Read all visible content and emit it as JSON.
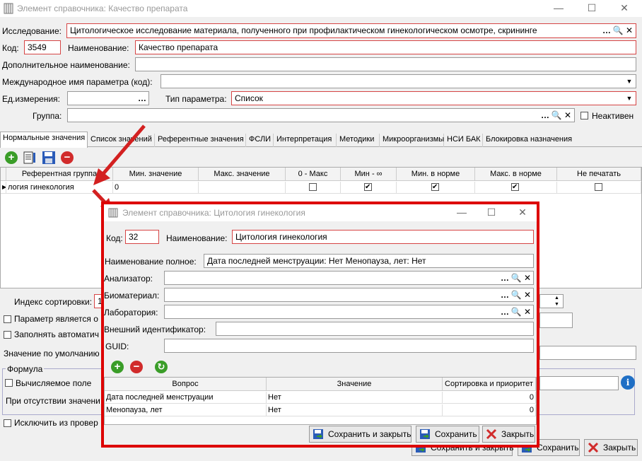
{
  "main_window": {
    "title": "Элемент справочника: Качество препарата",
    "controls": {
      "minimize": "—",
      "maximize": "☐",
      "close": "✕"
    },
    "fields": {
      "research_label": "Исследование:",
      "research_value": "Цитологическое исследование материала, полученного при профилактическом гинекологическом осмотре, скрининге",
      "code_label": "Код:",
      "code_value": "3549",
      "name_label": "Наименование:",
      "name_value": "Качество препарата",
      "extra_name_label": "Дополнительное наименование:",
      "extra_name_value": "",
      "intl_name_label": "Международное имя параметра (код):",
      "intl_name_value": "",
      "unit_label": "Ед.измерения:",
      "unit_value": "",
      "param_type_label": "Тип параметра:",
      "param_type_value": "Список",
      "group_label": "Группа:",
      "group_value": "",
      "inactive_label": "Неактивен"
    },
    "tabs": [
      "Нормальные значения",
      "Список значений",
      "Референтные значения",
      "ФСЛИ",
      "Интерпретация",
      "Методики",
      "Микроорганизмы",
      "НСИ БАК",
      "Блокировка назначения"
    ],
    "grid": {
      "columns": [
        "Референтная группа",
        "Мин. значение",
        "Макс. значение",
        "0 - Макс",
        "Мин - ∞",
        "Мин. в норме",
        "Макс. в норме",
        "Не печатать"
      ],
      "rows": [
        {
          "group": "логия гинекология",
          "min": "0",
          "max": "",
          "zero_max": false,
          "min_inf": true,
          "min_norm": true,
          "max_norm": true,
          "no_print": false
        }
      ]
    },
    "lower": {
      "sort_index_label": "Индекс сортировки:",
      "sort_index_value": "1",
      "param_is_label": "Параметр является о",
      "fill_auto_label": "Заполнять автоматич",
      "default_value_label": "Значение по умолчанию",
      "formula_group_label": "Формула",
      "computed_label": "Вычисляемое поле",
      "absence_label": "При отсутствии значени",
      "exclude_label": "Исключить из провер"
    },
    "buttons": {
      "save_close": "Сохранить и закрыть",
      "save": "Сохранить",
      "close": "Закрыть"
    }
  },
  "dialog": {
    "title": "Элемент справочника: Цитология гинекология",
    "controls": {
      "minimize": "—",
      "maximize": "☐",
      "close": "✕"
    },
    "code_label": "Код:",
    "code_value": "32",
    "name_label": "Наименование:",
    "name_value": "Цитология гинекология",
    "full_name_label": "Наименование полное:",
    "full_name_value": "Дата последней менструации: Нет Менопауза, лет: Нет",
    "analyzer_label": "Анализатор:",
    "biomaterial_label": "Биоматериал:",
    "lab_label": "Лаборатория:",
    "ext_id_label": "Внешний идентификатор:",
    "guid_label": "GUID:",
    "grid": {
      "columns": [
        "Вопрос",
        "Значение",
        "Сортировка и приоритет"
      ],
      "rows": [
        {
          "question": "Дата последней менструации",
          "value": "Нет",
          "sort": "0"
        },
        {
          "question": "Менопауза, лет",
          "value": "Нет",
          "sort": "0"
        }
      ]
    },
    "buttons": {
      "save_close": "Сохранить и закрыть",
      "save": "Сохранить",
      "close": "Закрыть"
    }
  }
}
